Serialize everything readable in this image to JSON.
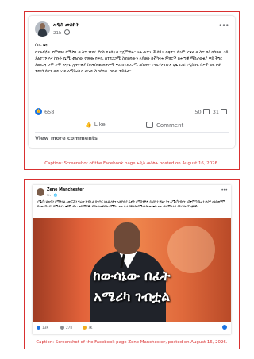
{
  "post1": {
    "author": "አዲስ መስከት",
    "time": "21h",
    "menu": "•••",
    "paragraphs": [
      "ሰበር ዜና",
      "በቀልደኛው የምክክር ኮሚሽን ውስጥ የነበሩ ያክስ ድርሰናብ ተጀምሯል። ዛሬ ጠዋት 3 ሰዓት በጃፓን ሰላም ሆቴል ውስጥ በስብሰባው ላይ ያልተገኙ እና ከቡራ ቤሚ ቲልበው የመጡ የሠቢ በተደጋጋሚ ስብሰባውን እያወኩ ከቭካናሐ ምክሮች በሐጣዊ ማስታወቂያ ዋይ ችግር ያልደጋና ጋሞ ጋሞ አጭር ኢትዮጵያ ስለዋሰባልመቻሎች ቀረ በተደጋጋሚ አስመጥ የብርሃኑ በሆኑ ጊዜ ነጋሪ የዲስኩር ሰዎች ወደ ቦታ ተደርጎ ሰሆን ወደ አገር ለማስረከብ መሄድ ስብሰባው በቢሮ ተይዟል።"
    ],
    "reactions_count": "658",
    "comments_count": "50",
    "shares_count": "31",
    "like_label": "Like",
    "comment_label": "Comment",
    "view_more": "View more comments",
    "caption": "Caption: Screenshot of the Facebook page አዲስ መስከት posted on August 16, 2026."
  },
  "post2": {
    "author": "Zene Manchester",
    "time": "5h · 🌐",
    "menu": "•••",
    "text": "አሜሪካ ህዝብን ለማታለል አውሮፓን ፍራውን ብሏል በቁጥር ለዚህ ለዋና ኢትዮጵያ ፈቃድ ለማስተዋዎ ያለበትን ሁኔታ እና አሜሪካ ብዛት አስቀምጣ ሲሆን ድጋፍ አልሰጠችም ብለው ጣልያን ከሚፈልጉ ቀደም ብሎ ወደ ምርጫ ሂደት ለመግባት የሚሰራ ነው ሲል በግልጽ የሚገልጽ ወረቀት ነው ቃለ ምልልስ ያደረጉት ፖለቲከኛ።",
    "overlay_line1": "ከውሳኔው በፊት",
    "overlay_line2": "አሜሪካ ገብቷል",
    "like_count": "13K",
    "comment_count": "278",
    "share_count": "7K",
    "caption": "Caption: Screenshot of the Facebook page Zene Manchester, posted on August 16, 2026."
  },
  "icons": {
    "like_badge": "👍",
    "thumb": "👍",
    "globe": "globe-icon",
    "comment": "comment-icon",
    "share": "share-icon"
  },
  "colors": {
    "border": "#d93030",
    "facebook_blue": "#1b74e4",
    "caption_red": "#d93030"
  }
}
